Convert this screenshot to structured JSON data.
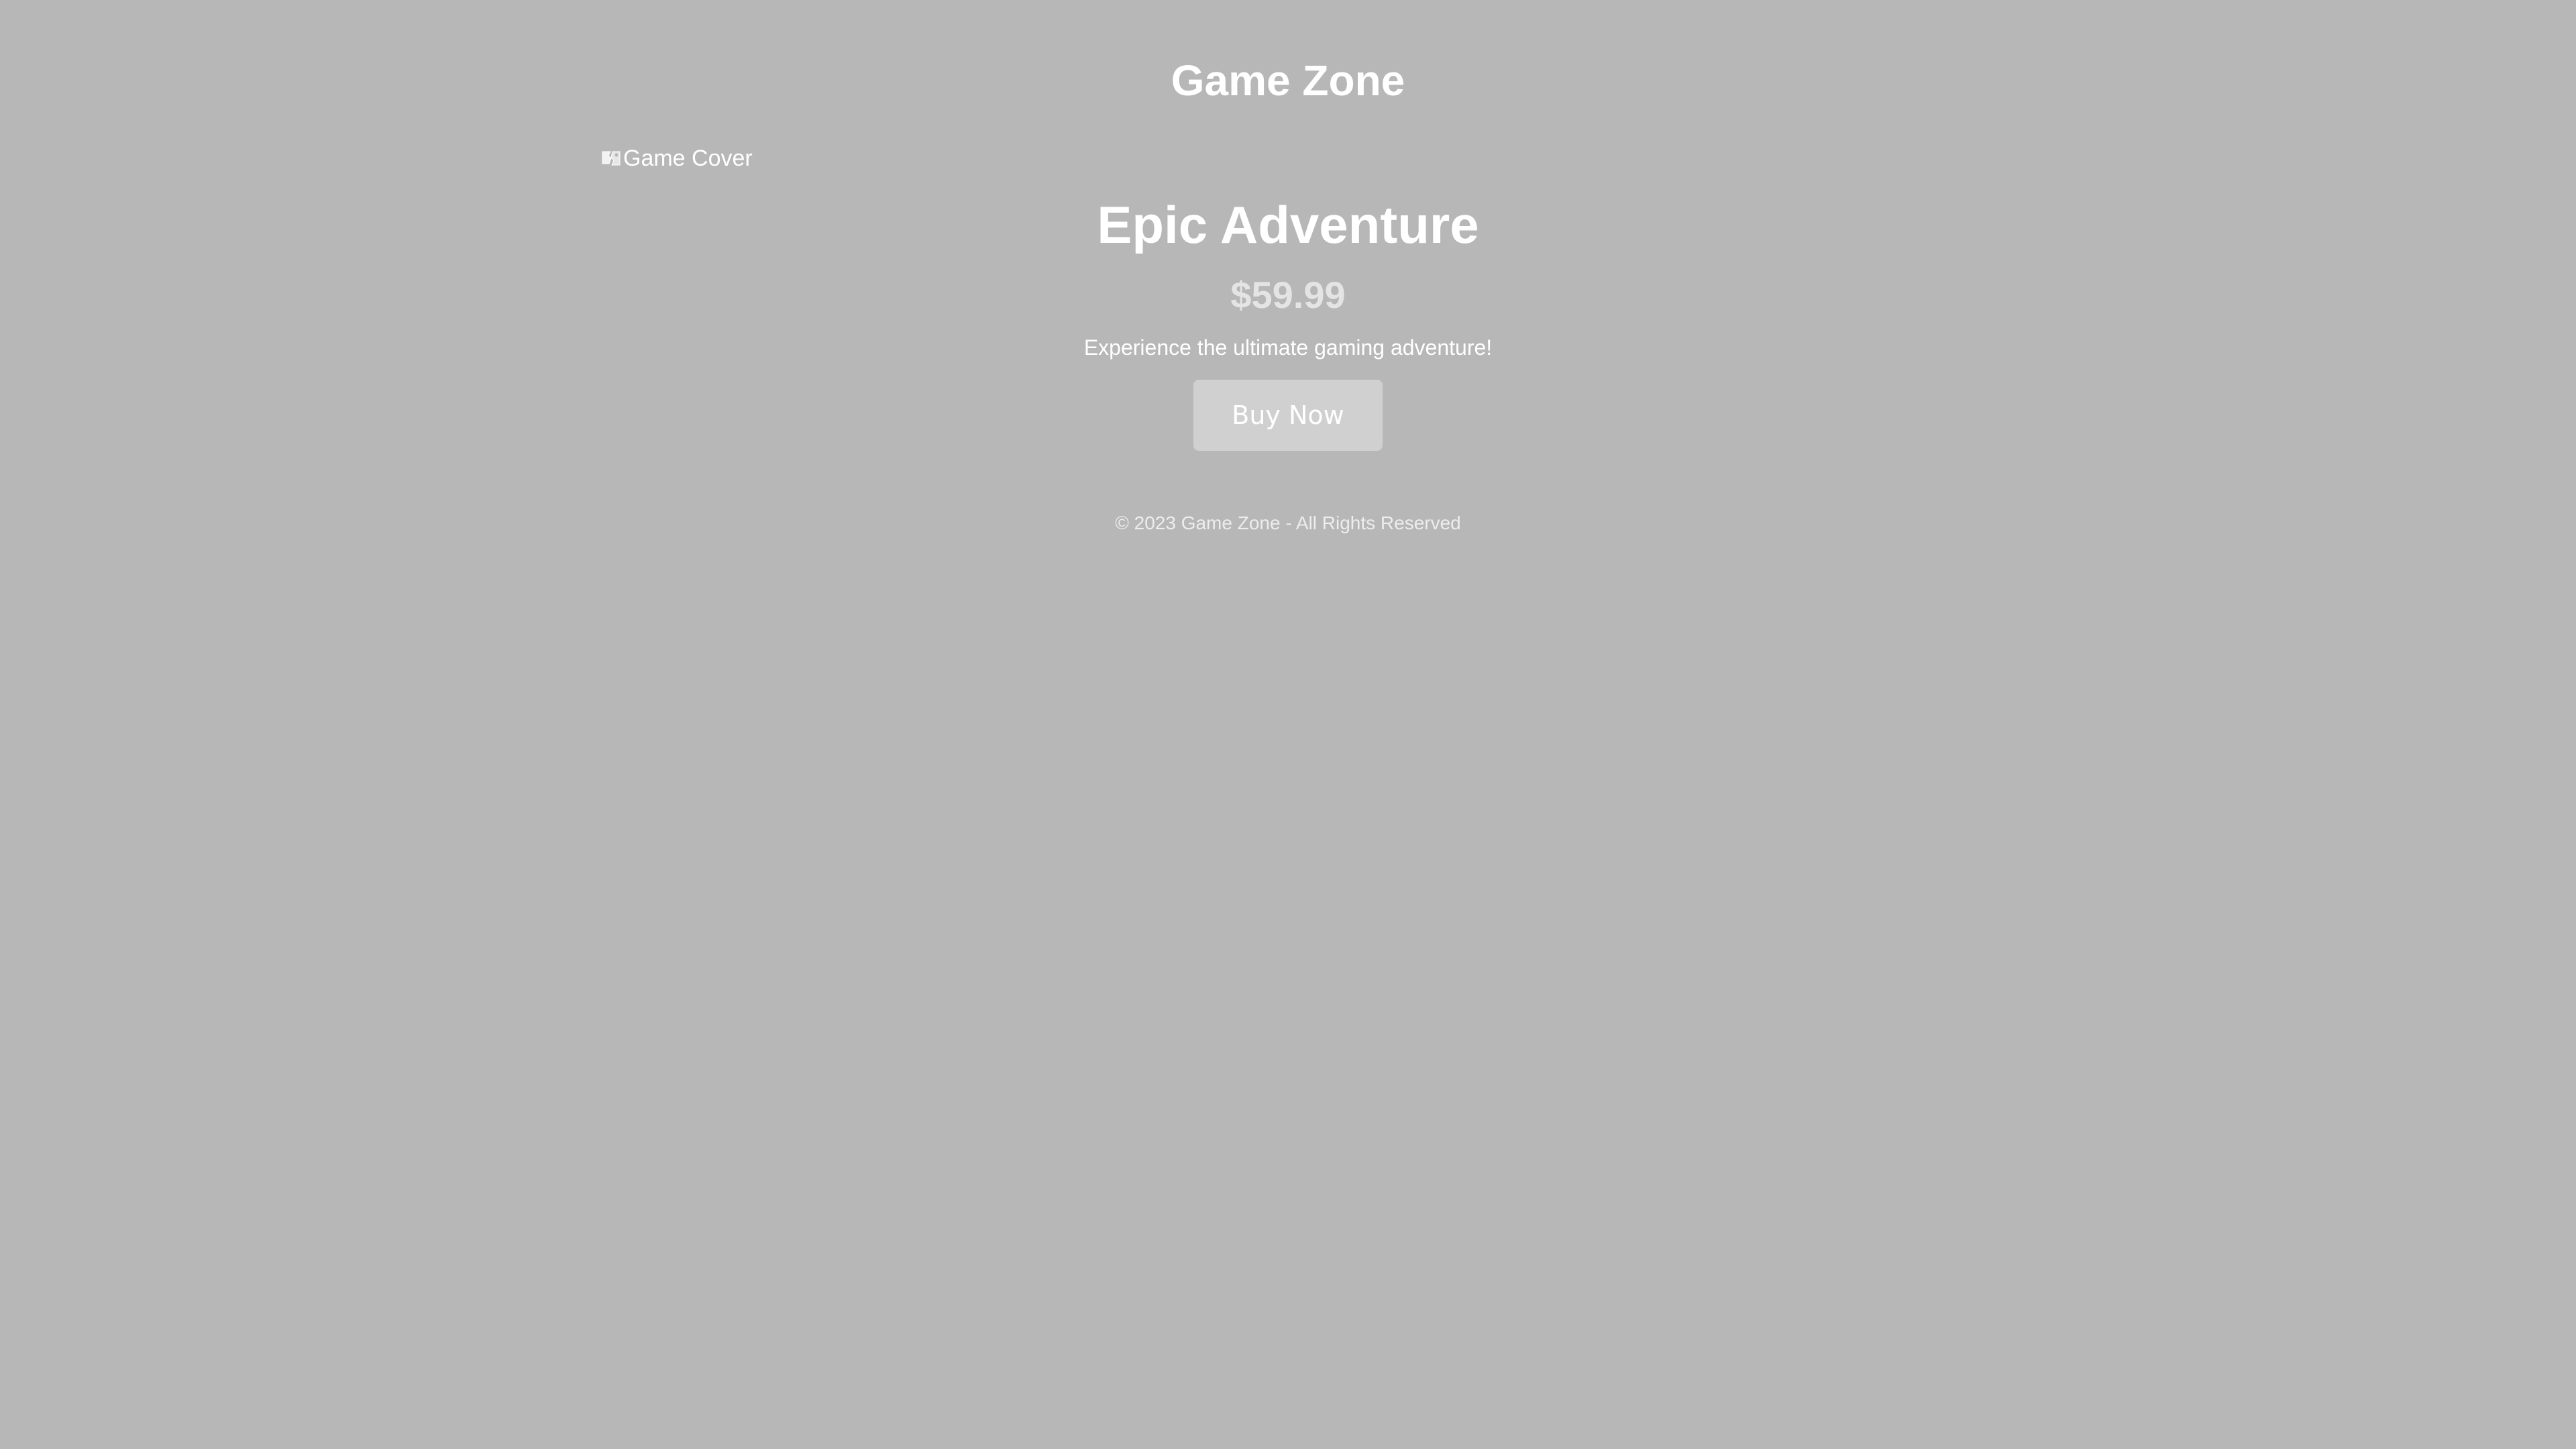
{
  "header": {
    "title": "Game Zone"
  },
  "product": {
    "cover_alt": "Game Cover",
    "title": "Epic Adventure",
    "price": "$59.99",
    "description": "Experience the ultimate gaming adventure!",
    "buy_label": "Buy Now"
  },
  "footer": {
    "copyright": "© 2023 Game Zone - All Rights Reserved"
  },
  "colors": {
    "background": "#b7b7b7",
    "text": "#ffffff",
    "price": "#e4e4e4",
    "button": "#d0d0d0"
  },
  "icons": {
    "cover": "broken-image-icon"
  }
}
